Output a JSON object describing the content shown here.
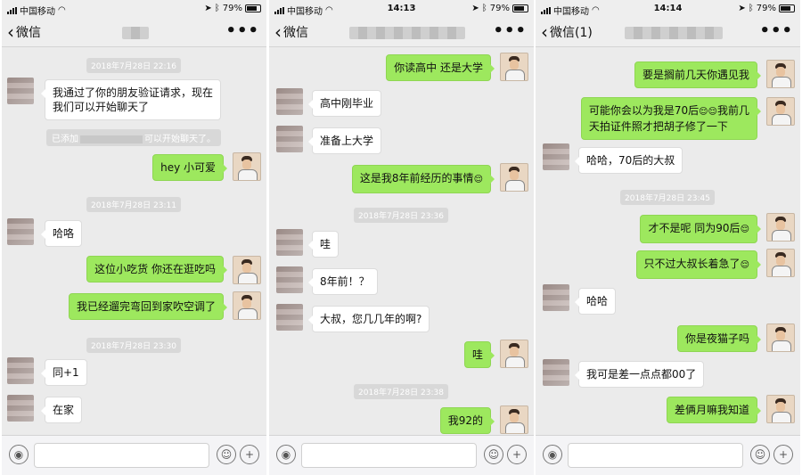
{
  "status": {
    "carrier": "中国移动",
    "battery": "79%",
    "times": [
      "",
      "14:13",
      "14:14"
    ]
  },
  "nav": {
    "back_labels": [
      "微信",
      "微信",
      "微信(1)"
    ],
    "more": "•••"
  },
  "panel1": {
    "timestamps": [
      "2018年7月28日 22:16",
      "2018年7月28日 23:11",
      "2018年7月28日 23:30"
    ],
    "system_prefix": "已添加",
    "system_suffix": "可以开始聊天了。",
    "messages": [
      "我通过了你的朋友验证请求，现在",
      "我们可以开始聊天了",
      "hey 小可爱",
      "哈咯",
      "这位小吃货 你还在逛吃吗",
      "我已经遛完弯回到家吹空调了",
      "同+1",
      "在家"
    ]
  },
  "panel2": {
    "timestamps": [
      "2018年7月28日 23:36",
      "2018年7月28日 23:38"
    ],
    "messages": [
      "你读高中 还是大学",
      "高中刚毕业",
      "准备上大学",
      "这是我8年前经历的事情",
      "哇",
      "8年前！？",
      "大叔，您几几年的啊?",
      "哇",
      "我92的"
    ]
  },
  "panel3": {
    "timestamps": [
      "2018年7月28日 23:45"
    ],
    "messages": [
      "要是搁前几天你遇见我",
      "可能你会以为我是70后",
      "我前几",
      "天拍证件照才把胡子修了一下",
      "哈哈，70后的大叔",
      "才不是呢 同为90后",
      "只不过大叔长着急了",
      "哈哈",
      "你是夜猫子吗",
      "我可是差一点点都00了",
      "差俩月嘛我知道"
    ]
  },
  "emoji_glyph": "😌",
  "inputbar": {
    "voice_icon": "voice-icon",
    "emoji_icon": "smile-icon",
    "plus_icon": "plus-icon"
  },
  "colors": {
    "out_bubble": "#9de85e",
    "in_bubble": "#ffffff",
    "background": "#ebebeb"
  }
}
